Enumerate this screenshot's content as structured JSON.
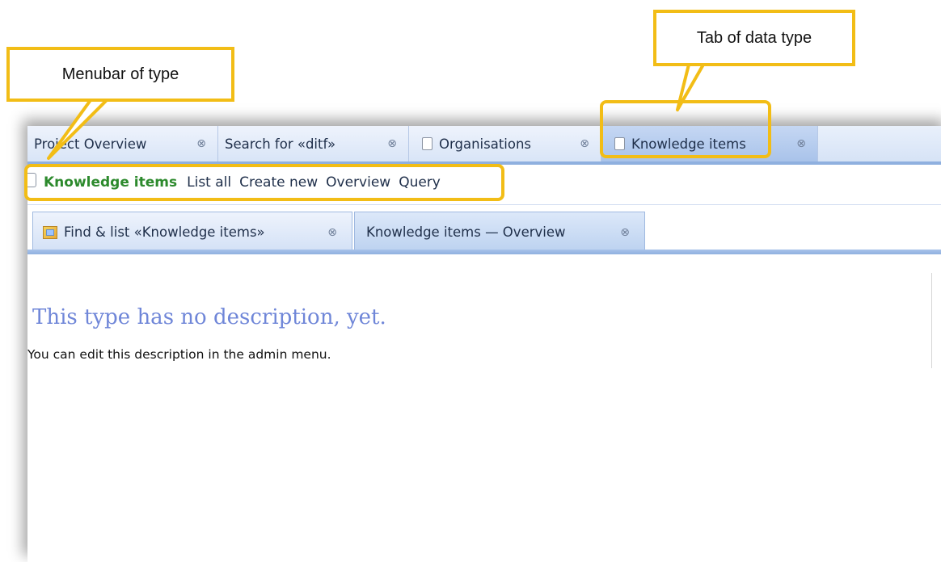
{
  "annotations": {
    "menubar_callout": "Menubar of type",
    "tab_callout": "Tab of data type"
  },
  "tabs": [
    {
      "label": "Project Overview",
      "close": "⊗",
      "icon": ""
    },
    {
      "label": "Search for «ditf»",
      "close": "⊗",
      "icon": ""
    },
    {
      "label": "Organisations",
      "close": "⊗",
      "icon": "document-icon"
    },
    {
      "label": "Knowledge items",
      "close": "⊗",
      "icon": "document-icon",
      "active": true
    }
  ],
  "menubar": {
    "type_label": "Knowledge items",
    "items": [
      "List all",
      "Create new",
      "Overview",
      "Query"
    ]
  },
  "subtabs": [
    {
      "label": "Find & list «Knowledge items»",
      "close": "⊗",
      "icon": "find-icon"
    },
    {
      "label": "Knowledge items — Overview",
      "close": "⊗",
      "active": true
    }
  ],
  "content": {
    "heading": "This type has no description, yet.",
    "description": "You can edit this description in the admin menu."
  },
  "colors": {
    "highlight": "#f2bd16",
    "type_label": "#2d8a2d",
    "heading": "#6f86d8",
    "tab_border": "#8fb0df"
  }
}
